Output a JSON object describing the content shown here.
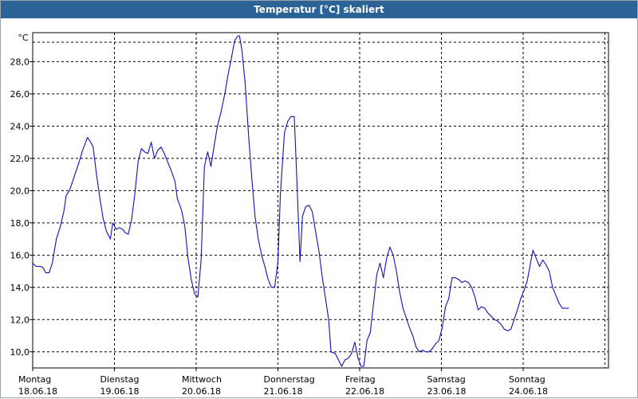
{
  "window": {
    "title": "Temperatur [°C] skaliert"
  },
  "chart_data": {
    "type": "line",
    "title": "Temperatur [°C] skaliert",
    "ylabel": "°C",
    "xlabel": "",
    "ylim": [
      9.0,
      29.8
    ],
    "xlim": [
      0,
      7
    ],
    "grid": true,
    "grid_style": "dashed",
    "yticks": [
      "10,0",
      "12,0",
      "14,0",
      "16,0",
      "18,0",
      "20,0",
      "22,0",
      "24,0",
      "26,0",
      "28,0"
    ],
    "ytick_values": [
      10,
      12,
      14,
      16,
      18,
      20,
      22,
      24,
      26,
      28
    ],
    "xticks": [
      {
        "day": "Montag",
        "date": "18.06.18"
      },
      {
        "day": "Dienstag",
        "date": "19.06.18"
      },
      {
        "day": "Mittwoch",
        "date": "20.06.18"
      },
      {
        "day": "Donnerstag",
        "date": "21.06.18"
      },
      {
        "day": "Freitag",
        "date": "22.06.18"
      },
      {
        "day": "Samstag",
        "date": "23.06.18"
      },
      {
        "day": "Sonntag",
        "date": "24.06.18"
      }
    ],
    "series": [
      {
        "color": "#1010c0",
        "x_unit": "days since Montag 18.06.18 00:00",
        "points": [
          [
            0.0,
            15.5
          ],
          [
            0.04,
            15.3
          ],
          [
            0.1,
            15.3
          ],
          [
            0.13,
            15.2
          ],
          [
            0.16,
            14.9
          ],
          [
            0.2,
            14.9
          ],
          [
            0.24,
            15.5
          ],
          [
            0.29,
            17.0
          ],
          [
            0.34,
            17.8
          ],
          [
            0.38,
            18.7
          ],
          [
            0.41,
            19.7
          ],
          [
            0.45,
            20.0
          ],
          [
            0.49,
            20.6
          ],
          [
            0.53,
            21.2
          ],
          [
            0.57,
            21.8
          ],
          [
            0.61,
            22.5
          ],
          [
            0.67,
            23.3
          ],
          [
            0.71,
            23.0
          ],
          [
            0.74,
            22.7
          ],
          [
            0.78,
            21.0
          ],
          [
            0.82,
            19.6
          ],
          [
            0.86,
            18.3
          ],
          [
            0.9,
            17.5
          ],
          [
            0.95,
            17.0
          ],
          [
            0.98,
            18.0
          ],
          [
            1.02,
            17.6
          ],
          [
            1.06,
            17.7
          ],
          [
            1.1,
            17.6
          ],
          [
            1.13,
            17.4
          ],
          [
            1.17,
            17.3
          ],
          [
            1.21,
            18.2
          ],
          [
            1.25,
            19.8
          ],
          [
            1.29,
            21.8
          ],
          [
            1.33,
            22.6
          ],
          [
            1.37,
            22.4
          ],
          [
            1.41,
            22.3
          ],
          [
            1.45,
            23.0
          ],
          [
            1.49,
            22.0
          ],
          [
            1.53,
            22.5
          ],
          [
            1.57,
            22.7
          ],
          [
            1.61,
            22.3
          ],
          [
            1.65,
            21.8
          ],
          [
            1.69,
            21.3
          ],
          [
            1.74,
            20.6
          ],
          [
            1.77,
            19.5
          ],
          [
            1.82,
            18.8
          ],
          [
            1.86,
            17.8
          ],
          [
            1.9,
            15.8
          ],
          [
            1.94,
            14.5
          ],
          [
            1.98,
            13.6
          ],
          [
            2.02,
            13.4
          ],
          [
            2.06,
            15.7
          ],
          [
            2.1,
            21.5
          ],
          [
            2.14,
            22.4
          ],
          [
            2.18,
            21.5
          ],
          [
            2.22,
            22.8
          ],
          [
            2.26,
            24.0
          ],
          [
            2.3,
            24.8
          ],
          [
            2.35,
            26.0
          ],
          [
            2.39,
            27.2
          ],
          [
            2.43,
            28.2
          ],
          [
            2.47,
            29.3
          ],
          [
            2.51,
            29.6
          ],
          [
            2.53,
            29.6
          ],
          [
            2.56,
            28.7
          ],
          [
            2.6,
            26.6
          ],
          [
            2.64,
            23.5
          ],
          [
            2.68,
            20.8
          ],
          [
            2.72,
            18.4
          ],
          [
            2.76,
            17.0
          ],
          [
            2.8,
            16.0
          ],
          [
            2.84,
            15.3
          ],
          [
            2.88,
            14.5
          ],
          [
            2.92,
            14.0
          ],
          [
            2.96,
            14.0
          ],
          [
            3.0,
            15.6
          ],
          [
            3.03,
            19.8
          ],
          [
            3.08,
            23.6
          ],
          [
            3.12,
            24.3
          ],
          [
            3.16,
            24.6
          ],
          [
            3.2,
            24.6
          ],
          [
            3.24,
            19.6
          ],
          [
            3.27,
            15.6
          ],
          [
            3.3,
            18.4
          ],
          [
            3.34,
            19.0
          ],
          [
            3.38,
            19.1
          ],
          [
            3.42,
            18.7
          ],
          [
            3.46,
            17.5
          ],
          [
            3.5,
            16.3
          ],
          [
            3.54,
            14.7
          ],
          [
            3.58,
            13.4
          ],
          [
            3.62,
            12.0
          ],
          [
            3.65,
            10.0
          ],
          [
            3.7,
            9.9
          ],
          [
            3.74,
            9.5
          ],
          [
            3.78,
            9.1
          ],
          [
            3.82,
            9.5
          ],
          [
            3.86,
            9.6
          ],
          [
            3.9,
            9.9
          ],
          [
            3.94,
            10.6
          ],
          [
            3.98,
            9.6
          ],
          [
            4.02,
            9.1
          ],
          [
            4.05,
            9.1
          ],
          [
            4.09,
            10.7
          ],
          [
            4.13,
            11.2
          ],
          [
            4.17,
            13.0
          ],
          [
            4.21,
            14.8
          ],
          [
            4.25,
            15.5
          ],
          [
            4.29,
            14.6
          ],
          [
            4.33,
            15.8
          ],
          [
            4.37,
            16.5
          ],
          [
            4.41,
            16.0
          ],
          [
            4.45,
            15.0
          ],
          [
            4.49,
            13.7
          ],
          [
            4.53,
            12.7
          ],
          [
            4.57,
            12.1
          ],
          [
            4.61,
            11.5
          ],
          [
            4.65,
            11.0
          ],
          [
            4.69,
            10.3
          ],
          [
            4.73,
            10.0
          ],
          [
            4.77,
            10.1
          ],
          [
            4.81,
            10.0
          ],
          [
            4.85,
            10.0
          ],
          [
            4.89,
            10.2
          ],
          [
            4.93,
            10.5
          ],
          [
            4.97,
            10.7
          ],
          [
            5.01,
            11.5
          ],
          [
            5.05,
            12.8
          ],
          [
            5.09,
            13.3
          ],
          [
            5.13,
            14.6
          ],
          [
            5.17,
            14.6
          ],
          [
            5.21,
            14.5
          ],
          [
            5.25,
            14.3
          ],
          [
            5.29,
            14.4
          ],
          [
            5.33,
            14.3
          ],
          [
            5.37,
            14.0
          ],
          [
            5.41,
            13.4
          ],
          [
            5.45,
            12.6
          ],
          [
            5.49,
            12.8
          ],
          [
            5.53,
            12.7
          ],
          [
            5.57,
            12.4
          ],
          [
            5.61,
            12.2
          ],
          [
            5.65,
            12.0
          ],
          [
            5.69,
            11.9
          ],
          [
            5.73,
            11.7
          ],
          [
            5.77,
            11.4
          ],
          [
            5.81,
            11.3
          ],
          [
            5.85,
            11.4
          ],
          [
            5.89,
            12.0
          ],
          [
            5.93,
            12.6
          ],
          [
            5.97,
            13.3
          ],
          [
            6.01,
            13.8
          ],
          [
            6.05,
            14.4
          ],
          [
            6.09,
            15.5
          ],
          [
            6.12,
            16.3
          ],
          [
            6.16,
            15.8
          ],
          [
            6.2,
            15.3
          ],
          [
            6.24,
            15.7
          ],
          [
            6.28,
            15.4
          ],
          [
            6.32,
            15.0
          ],
          [
            6.36,
            14.0
          ],
          [
            6.4,
            13.5
          ],
          [
            6.44,
            13.0
          ],
          [
            6.48,
            12.7
          ],
          [
            6.52,
            12.7
          ],
          [
            6.56,
            12.7
          ]
        ]
      }
    ]
  }
}
